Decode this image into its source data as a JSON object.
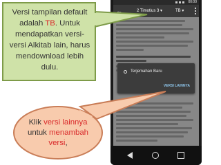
{
  "phone": {
    "status_time": "00:00",
    "app_bar": {
      "reference": "2 Timotius 3",
      "version": "TB"
    },
    "dialog": {
      "option_label": "Terjemahan Baru",
      "action_label": "VERSI LAINNYA"
    }
  },
  "callouts": {
    "top": {
      "line_1": "Versi tampilan default",
      "line_2_prefix": "adalah ",
      "line_2_highlight": "TB",
      "line_2_suffix": ". Untuk",
      "line_3": "mendapatkan versi-",
      "line_4": "versi Alkitab lain, harus",
      "line_5": "mendownload lebih",
      "line_6": "dulu.",
      "fill_color": "#cfe2a8",
      "border_color": "#7e9b49"
    },
    "bottom": {
      "line_1_prefix": "Klik ",
      "line_1_highlight": "versi lainnya",
      "line_2_prefix": "untuk  ",
      "line_2_highlight": "menambah",
      "line_3_highlight": "versi",
      "line_3_suffix": ",",
      "fill_color": "#f8cbad",
      "border_color": "#c97d57"
    },
    "highlight_color": "#d9292a"
  }
}
